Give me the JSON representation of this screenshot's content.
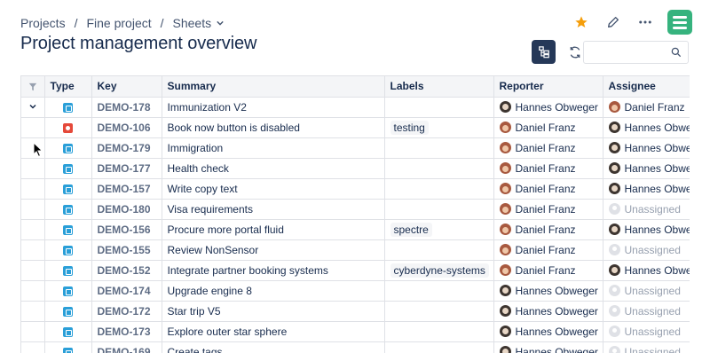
{
  "breadcrumb": {
    "items": [
      "Projects",
      "Fine project",
      "Sheets"
    ]
  },
  "page": {
    "title": "Project management overview"
  },
  "search": {
    "placeholder": ""
  },
  "colors": {
    "star": "#f59e0b",
    "logo": "#36b37e",
    "task_icon": "#2a9fd8",
    "bug_icon": "#e5493a",
    "toolbar_active": "#253858"
  },
  "table": {
    "headers": [
      "Type",
      "Key",
      "Summary",
      "Labels",
      "Reporter",
      "Assignee"
    ],
    "rows": [
      {
        "type": "task",
        "key": "DEMO-178",
        "summary": "Immunization V2",
        "label": "",
        "reporter": "Hannes Obweger",
        "reporter_av": "hannes",
        "assignee": "Daniel Franz",
        "assignee_av": "daniel"
      },
      {
        "type": "bug",
        "key": "DEMO-106",
        "summary": "Book now button is disabled",
        "label": "testing",
        "reporter": "Daniel Franz",
        "reporter_av": "daniel",
        "assignee": "Hannes Obweger",
        "assignee_av": "hannes"
      },
      {
        "type": "task",
        "key": "DEMO-179",
        "summary": "Immigration",
        "label": "",
        "reporter": "Daniel Franz",
        "reporter_av": "daniel",
        "assignee": "Hannes Obweger",
        "assignee_av": "hannes"
      },
      {
        "type": "task",
        "key": "DEMO-177",
        "summary": "Health check",
        "label": "",
        "reporter": "Daniel Franz",
        "reporter_av": "daniel",
        "assignee": "Hannes Obweger",
        "assignee_av": "hannes"
      },
      {
        "type": "task",
        "key": "DEMO-157",
        "summary": "Write copy text",
        "label": "",
        "reporter": "Daniel Franz",
        "reporter_av": "daniel",
        "assignee": "Hannes Obweger",
        "assignee_av": "hannes"
      },
      {
        "type": "task",
        "key": "DEMO-180",
        "summary": "Visa requirements",
        "label": "",
        "reporter": "Daniel Franz",
        "reporter_av": "daniel",
        "assignee": "Unassigned",
        "assignee_av": "none"
      },
      {
        "type": "task",
        "key": "DEMO-156",
        "summary": "Procure more portal fluid",
        "label": "spectre",
        "reporter": "Daniel Franz",
        "reporter_av": "daniel",
        "assignee": "Hannes Obweger",
        "assignee_av": "hannes"
      },
      {
        "type": "task",
        "key": "DEMO-155",
        "summary": "Review NonSensor",
        "label": "",
        "reporter": "Daniel Franz",
        "reporter_av": "daniel",
        "assignee": "Unassigned",
        "assignee_av": "none"
      },
      {
        "type": "task",
        "key": "DEMO-152",
        "summary": "Integrate partner booking systems",
        "label": "cyberdyne-systems",
        "reporter": "Daniel Franz",
        "reporter_av": "daniel",
        "assignee": "Hannes Obweger",
        "assignee_av": "hannes"
      },
      {
        "type": "task",
        "key": "DEMO-174",
        "summary": "Upgrade engine 8",
        "label": "",
        "reporter": "Hannes Obweger",
        "reporter_av": "hannes",
        "assignee": "Unassigned",
        "assignee_av": "none"
      },
      {
        "type": "task",
        "key": "DEMO-172",
        "summary": "Star trip V5",
        "label": "",
        "reporter": "Hannes Obweger",
        "reporter_av": "hannes",
        "assignee": "Unassigned",
        "assignee_av": "none"
      },
      {
        "type": "task",
        "key": "DEMO-173",
        "summary": "Explore outer star sphere",
        "label": "",
        "reporter": "Hannes Obweger",
        "reporter_av": "hannes",
        "assignee": "Unassigned",
        "assignee_av": "none"
      },
      {
        "type": "task",
        "key": "DEMO-169",
        "summary": "Create tags",
        "label": "",
        "reporter": "Hannes Obweger",
        "reporter_av": "hannes",
        "assignee": "Unassigned",
        "assignee_av": "none"
      }
    ]
  }
}
